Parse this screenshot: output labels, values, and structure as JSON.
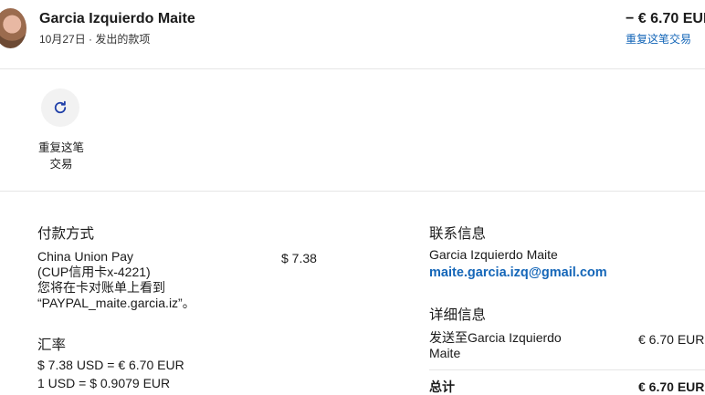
{
  "header": {
    "name": "Garcia Izquierdo Maite",
    "meta": "10月27日 · 发出的款项",
    "amount": "− € 6.70 EUR",
    "repeat_link": "重复这笔交易"
  },
  "actions": {
    "repeat_label": "重复这笔交易",
    "icon": "refresh-icon"
  },
  "payment": {
    "title": "付款方式",
    "method_line1": "China Union Pay",
    "method_line2": "(CUP信用卡x-4221)",
    "method_line3": "您将在卡对账单上看到",
    "method_line4": "“PAYPAL_maite.garcia.iz”。",
    "amount": "$ 7.38"
  },
  "exchange": {
    "title": "汇率",
    "line1": "$ 7.38 USD = € 6.70 EUR",
    "line2": "1 USD = $ 0.9079 EUR"
  },
  "contact": {
    "title": "联系信息",
    "name": "Garcia Izquierdo Maite",
    "email": "maite.garcia.izq@gmail.com"
  },
  "details": {
    "title": "详细信息",
    "sent_to_line1": "发送至Garcia Izquierdo",
    "sent_to_line2": "Maite",
    "sent_amount": "€ 6.70 EUR",
    "total_label": "总计",
    "total_amount": "€ 6.70 EUR"
  },
  "colors": {
    "link": "#1466b8",
    "icon": "#1f3fa8"
  }
}
